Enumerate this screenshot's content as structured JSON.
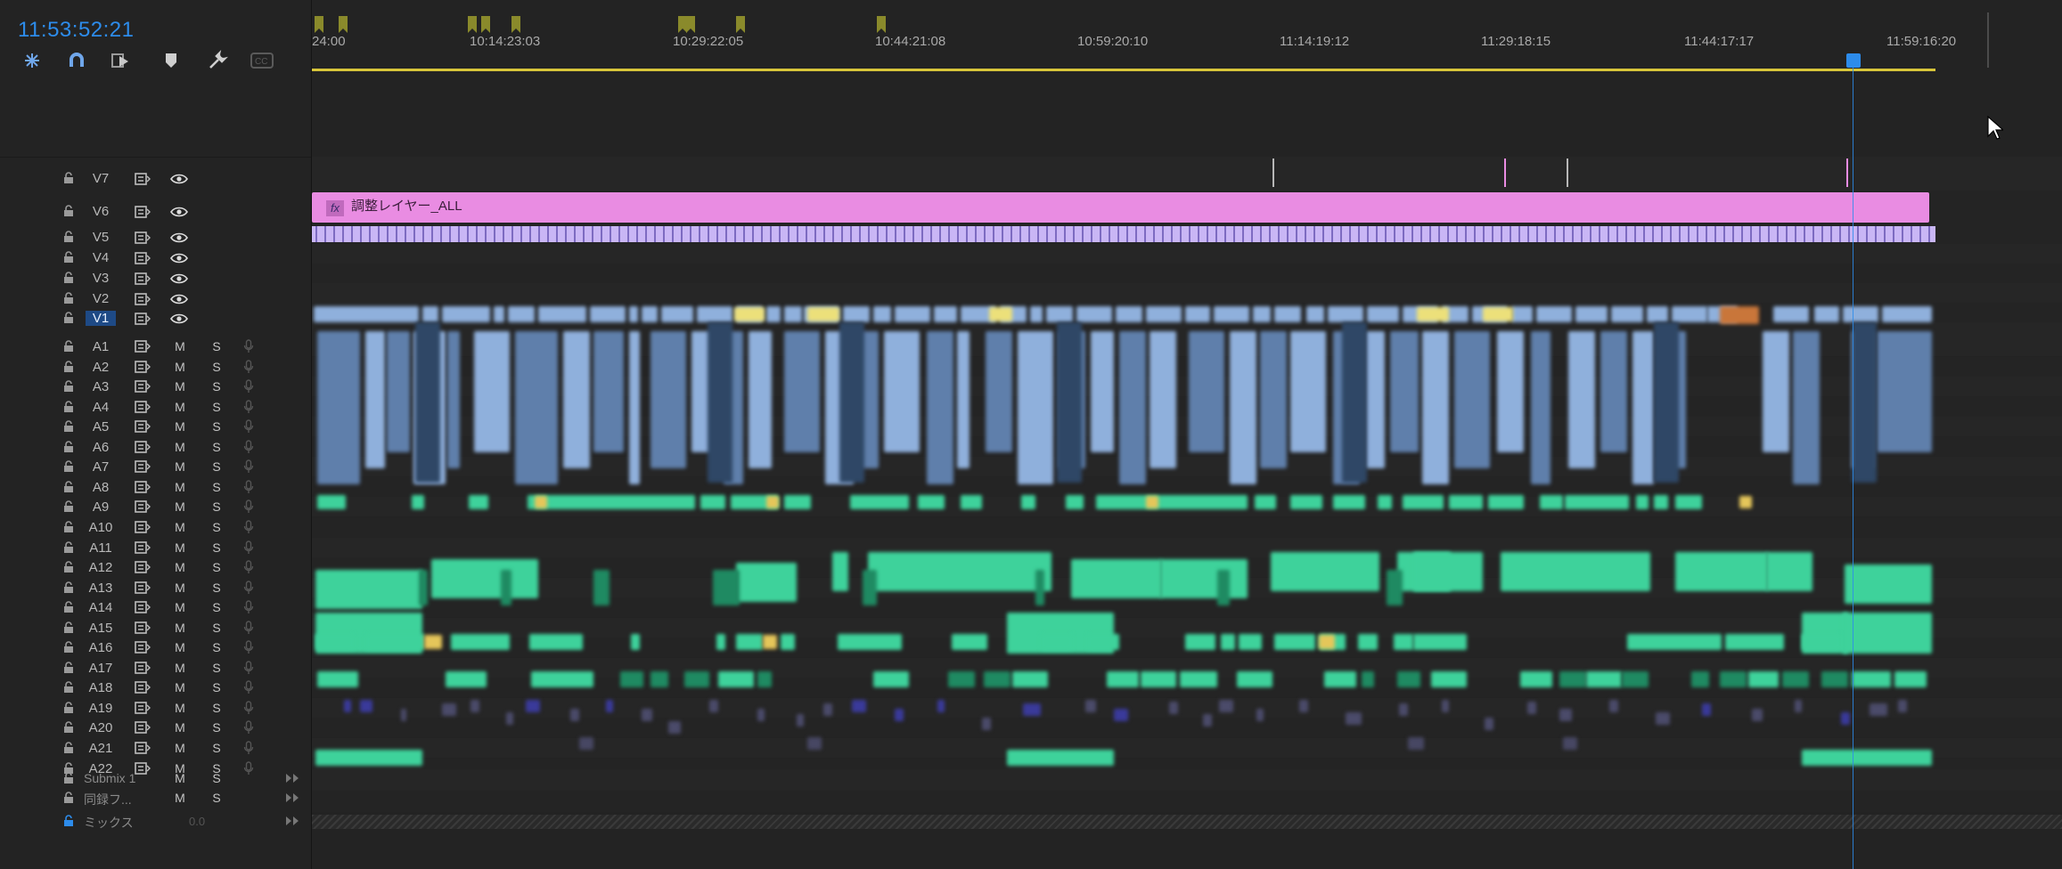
{
  "header": {
    "timecode": "11:53:52:21",
    "tools": [
      "snap-icon",
      "magnet-link-icon",
      "linked-selection-icon",
      "add-marker-icon",
      "wrench-settings-icon",
      "captions-icon"
    ]
  },
  "ruler": {
    "labels": [
      "24:00",
      "10:14:23:03",
      "10:29:22:05",
      "10:44:21:08",
      "10:59:20:10",
      "11:14:19:12",
      "11:29:18:15",
      "11:44:17:17",
      "11:59:16:20"
    ]
  },
  "video_tracks": [
    {
      "name": "V7",
      "selected": false
    },
    {
      "name": "V6",
      "selected": false
    },
    {
      "name": "V5",
      "selected": false
    },
    {
      "name": "V4",
      "selected": false
    },
    {
      "name": "V3",
      "selected": false
    },
    {
      "name": "V2",
      "selected": false
    },
    {
      "name": "V1",
      "selected": true
    }
  ],
  "audio_tracks": [
    "A1",
    "A2",
    "A3",
    "A4",
    "A5",
    "A6",
    "A7",
    "A8",
    "A9",
    "A10",
    "A11",
    "A12",
    "A13",
    "A14",
    "A15",
    "A16",
    "A17",
    "A18",
    "A19",
    "A20",
    "A21",
    "A22"
  ],
  "audio_mute_label": "M",
  "audio_solo_label": "S",
  "submix": [
    {
      "name": "Submix 1",
      "m": "M",
      "s": "S"
    },
    {
      "name": "同録フ...",
      "m": "M",
      "s": "S"
    }
  ],
  "mix": {
    "name": "ミックス",
    "level": "0.0"
  },
  "clips": {
    "adjustment_layer_label": "調整レイヤー_ALL",
    "fx_badge": "fx"
  },
  "colors": {
    "timecode": "#2d8ceb",
    "playhead": "#2d8ceb",
    "work_area": "#d7c53a",
    "adjustment_layer": "#e98ce2",
    "video_clip": "#8fb0dc",
    "audio_clip": "#3ed29b",
    "marker": "#8a8a2b"
  }
}
